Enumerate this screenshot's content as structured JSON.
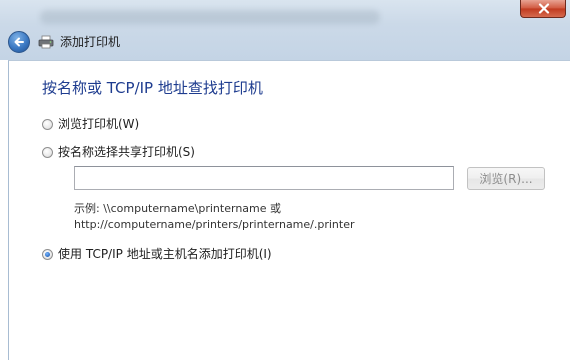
{
  "window": {
    "close_label": "close",
    "accent": "#1e3c8f",
    "close_color": "#c0391f"
  },
  "header": {
    "back_icon": "back-arrow-icon",
    "printer_icon": "printer-icon",
    "title": "添加打印机"
  },
  "main": {
    "title": "按名称或 TCP/IP 地址查找打印机",
    "options": [
      {
        "label": "浏览打印机(W)",
        "selected": false
      },
      {
        "label": "按名称选择共享打印机(S)",
        "selected": false
      },
      {
        "label": "使用 TCP/IP 地址或主机名添加打印机(I)",
        "selected": true
      }
    ],
    "share_input": {
      "value": "",
      "placeholder": ""
    },
    "browse_button": "浏览(R)...",
    "example_line1": "示例: \\\\computername\\printername 或",
    "example_line2": "http://computername/printers/printername/.printer"
  }
}
